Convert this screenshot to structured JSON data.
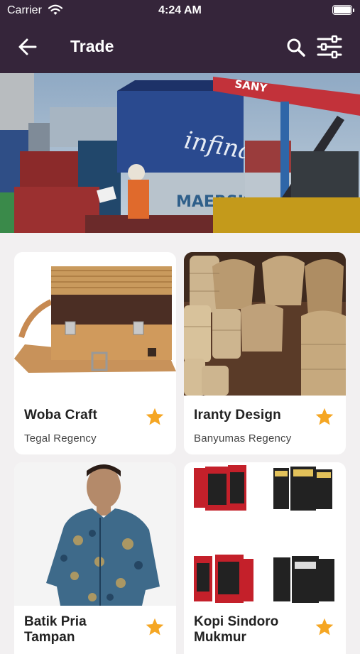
{
  "status": {
    "carrier": "Carrier",
    "time": "4:24 AM"
  },
  "header": {
    "title": "Trade"
  },
  "cards": [
    {
      "name": "Woba Craft",
      "region": "Tegal Regency"
    },
    {
      "name": "Iranty Design",
      "region": "Banyumas Regency"
    },
    {
      "name": "Batik Pria Tampan",
      "region": ""
    },
    {
      "name": "Kopi Sindoro Mukmur",
      "region": ""
    }
  ],
  "banner_text": {
    "container_brand": "infinay",
    "container_brand2": "MAERSK",
    "crane_brand": "SANY"
  },
  "colors": {
    "topbar": "#35253a",
    "star": "#f5a623",
    "background": "#f2f0f1"
  }
}
